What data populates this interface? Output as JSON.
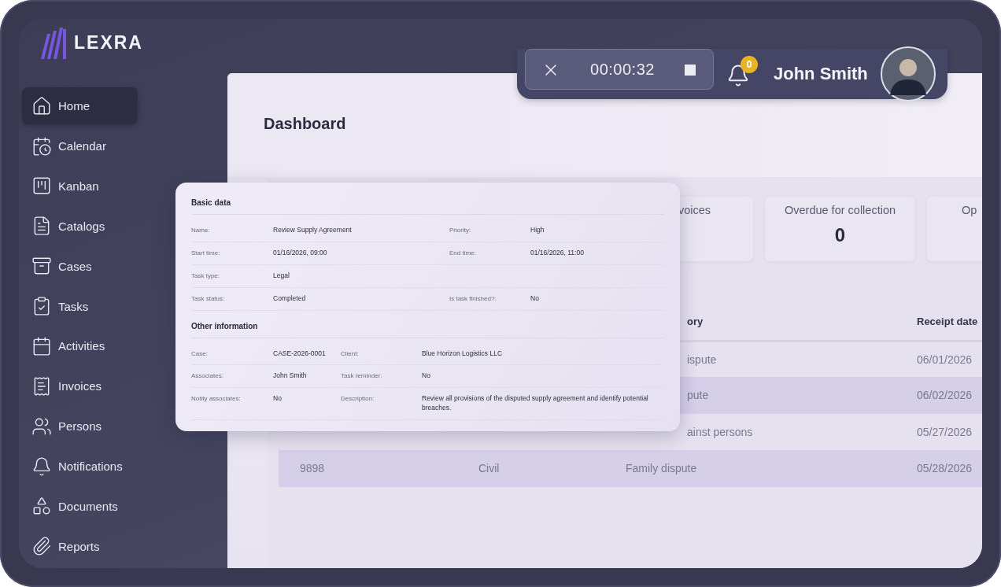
{
  "logo": {
    "text": "LEXRA"
  },
  "sidebar": {
    "items": [
      {
        "label": "Home",
        "selected": true
      },
      {
        "label": "Calendar",
        "selected": false
      },
      {
        "label": "Kanban",
        "selected": false
      },
      {
        "label": "Catalogs",
        "selected": false
      },
      {
        "label": "Cases",
        "selected": false
      },
      {
        "label": "Tasks",
        "selected": false
      },
      {
        "label": "Activities",
        "selected": false
      },
      {
        "label": "Invoices",
        "selected": false
      },
      {
        "label": "Persons",
        "selected": false
      },
      {
        "label": "Notifications",
        "selected": false
      },
      {
        "label": "Documents",
        "selected": false
      },
      {
        "label": "Reports",
        "selected": false
      }
    ]
  },
  "timer": {
    "time": "00:00:32"
  },
  "notifications": {
    "count": "0"
  },
  "user": {
    "name": "John Smith"
  },
  "page": {
    "title": "Dashboard"
  },
  "stats": [
    {
      "label": "voices"
    },
    {
      "label": "Overdue for collection",
      "value": "0"
    },
    {
      "label": "Op"
    }
  ],
  "table": {
    "headers": {
      "column_3": "ory",
      "column_4": "Receipt date"
    },
    "rows": [
      {
        "column_3": "ispute",
        "column_4": "06/01/2026"
      },
      {
        "column_3": "pute",
        "column_4": "06/02/2026"
      },
      {
        "column_3": "ainst persons",
        "column_4": "05/27/2026"
      },
      {
        "column_1": "9898",
        "column_2": "Civil",
        "column_3": "Family dispute",
        "column_4": "05/28/2026"
      }
    ]
  },
  "task_card": {
    "sections": [
      {
        "title": "Basic data",
        "kind": "wide",
        "rows": [
          [
            {
              "label": "Name:",
              "value": "Review Supply Agreement"
            },
            {
              "label": "Priority:",
              "value": "High"
            }
          ],
          [
            {
              "label": "Start time:",
              "value": "01/16/2026, 09:00"
            },
            {
              "label": "End time:",
              "value": "01/16/2026, 11:00"
            }
          ],
          [
            {
              "label": "Task type:",
              "value": "Legal"
            }
          ],
          [
            {
              "label": "Task status:",
              "value": "Completed"
            },
            {
              "label": "Is task finished?:",
              "value": "No"
            }
          ]
        ]
      },
      {
        "title": "Other information",
        "kind": "narrow",
        "rows": [
          [
            {
              "label": "Case:",
              "value": "CASE-2026-0001"
            },
            {
              "label": "Client:",
              "value": "Blue Horizon Logistics LLC"
            }
          ],
          [
            {
              "label": "Associates:",
              "value": "John Smith"
            },
            {
              "label": "Task reminder:",
              "value": "No"
            }
          ],
          [
            {
              "label": "Notify associates:",
              "value": "No"
            },
            {
              "label": "Description:",
              "value": "Review all provisions of the disputed supply agreement and identify potential breaches."
            }
          ]
        ]
      }
    ]
  }
}
